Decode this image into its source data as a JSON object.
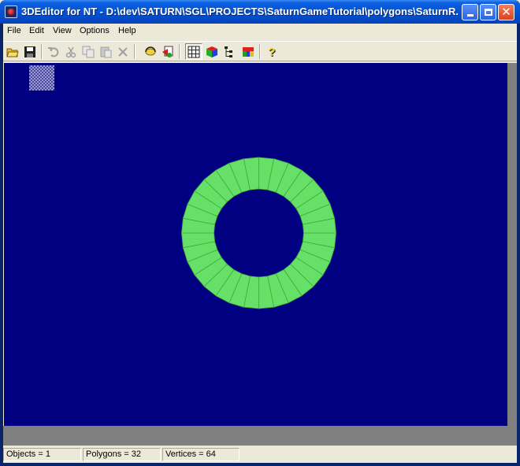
{
  "window": {
    "title": "3DEditor for NT - D:\\dev\\SATURN\\SGL\\PROJECTS\\SaturnGameTutorial\\polygons\\SaturnR...",
    "controls": {
      "minimize": "minimize-icon",
      "maximize": "maximize-icon",
      "close": "close-icon"
    }
  },
  "menu": {
    "items": [
      {
        "label": "File"
      },
      {
        "label": "Edit"
      },
      {
        "label": "View"
      },
      {
        "label": "Options"
      },
      {
        "label": "Help"
      }
    ]
  },
  "toolbar": {
    "buttons": [
      {
        "icon": "open-folder-icon",
        "enabled": true
      },
      {
        "icon": "save-disk-icon",
        "enabled": true
      },
      {
        "icon": "undo-icon",
        "enabled": false
      },
      {
        "icon": "cut-icon",
        "enabled": false
      },
      {
        "icon": "copy-icon",
        "enabled": false
      },
      {
        "icon": "paste-icon",
        "enabled": false
      },
      {
        "icon": "delete-icon",
        "enabled": false
      },
      {
        "icon": "rotate-object-icon",
        "enabled": true
      },
      {
        "icon": "render-view-icon",
        "enabled": true
      },
      {
        "icon": "grid-view-icon",
        "enabled": true,
        "pressed": true
      },
      {
        "icon": "color-cube-icon",
        "enabled": true
      },
      {
        "icon": "tree-view-icon",
        "enabled": true
      },
      {
        "icon": "palette-icon",
        "enabled": true
      },
      {
        "icon": "help-icon",
        "enabled": true
      }
    ]
  },
  "viewport": {
    "background_color": "#000080",
    "model_color": "#66e066",
    "model_line_color": "#3faa3f",
    "ring_segments": 32
  },
  "status": {
    "objects": "Objects = 1",
    "polygons": "Polygons = 32",
    "vertices": "Vertices = 64"
  }
}
